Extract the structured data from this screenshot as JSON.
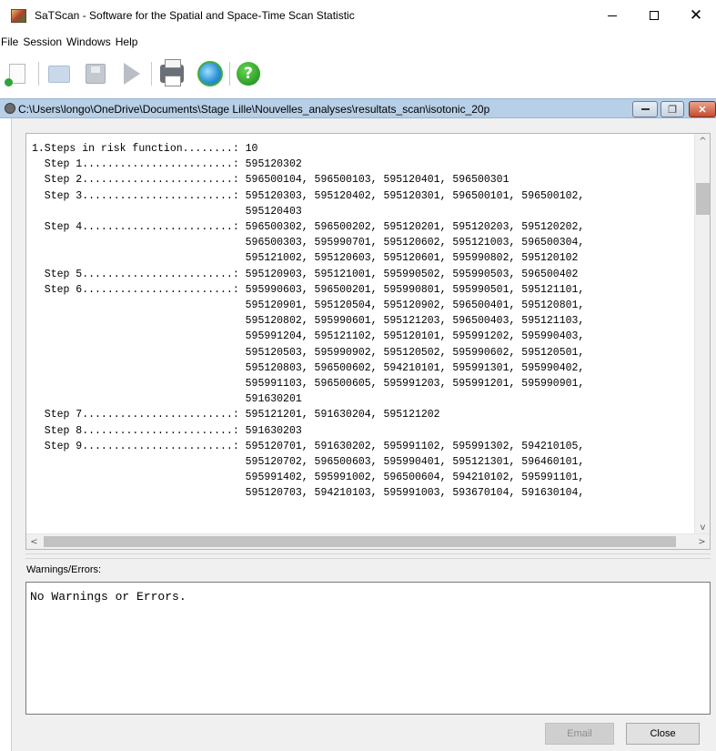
{
  "window": {
    "title": "SaTScan - Software for the Spatial and Space-Time Scan Statistic",
    "controls": {
      "minimize": "minimize",
      "maximize": "maximize",
      "close": "close"
    }
  },
  "menu": {
    "items": [
      "File",
      "Session",
      "Windows",
      "Help"
    ]
  },
  "toolbar": {
    "buttons": [
      {
        "name": "new-session-icon"
      },
      {
        "name": "open-folder-icon"
      },
      {
        "name": "save-icon"
      },
      {
        "name": "run-icon"
      },
      {
        "name": "print-icon"
      },
      {
        "name": "update-icon"
      },
      {
        "name": "help-icon",
        "glyph": "?"
      }
    ]
  },
  "child_window": {
    "path": "C:\\Users\\longo\\OneDrive\\Documents\\Stage Lille\\Nouvelles_analyses\\resultats_scan\\isotonic_20p",
    "results_text": "1.Steps in risk function........: 10\n  Step 1........................: 595120302\n  Step 2........................: 596500104, 596500103, 595120401, 596500301\n  Step 3........................: 595120303, 595120402, 595120301, 596500101, 596500102,\n                                  595120403\n  Step 4........................: 596500302, 596500202, 595120201, 595120203, 595120202,\n                                  596500303, 595990701, 595120602, 595121003, 596500304,\n                                  595121002, 595120603, 595120601, 595990802, 595120102\n  Step 5........................: 595120903, 595121001, 595990502, 595990503, 596500402\n  Step 6........................: 595990603, 596500201, 595990801, 595990501, 595121101,\n                                  595120901, 595120504, 595120902, 596500401, 595120801,\n                                  595120802, 595990601, 595121203, 596500403, 595121103,\n                                  595991204, 595121102, 595120101, 595991202, 595990403,\n                                  595120503, 595990902, 595120502, 595990602, 595120501,\n                                  595120803, 596500602, 594210101, 595991301, 595990402,\n                                  595991103, 596500605, 595991203, 595991201, 595990901,\n                                  591630201\n  Step 7........................: 595121201, 591630204, 595121202\n  Step 8........................: 591630203\n  Step 9........................: 595120701, 591630202, 595991102, 595991302, 594210105,\n                                  595120702, 596500603, 595990401, 595121301, 596460101,\n                                  595991402, 595991002, 596500604, 594210102, 595991101,\n                                  595120703, 594210103, 595991003, 593670104, 591630104,",
    "warnings_label": "Warnings/Errors:",
    "warnings_text": "No Warnings or Errors.",
    "buttons": {
      "email": "Email",
      "close": "Close"
    }
  },
  "colors": {
    "child_titlebar": "#b7cfe7",
    "panel_bg": "#f0f0f0",
    "close_button": "#c74b2d"
  }
}
